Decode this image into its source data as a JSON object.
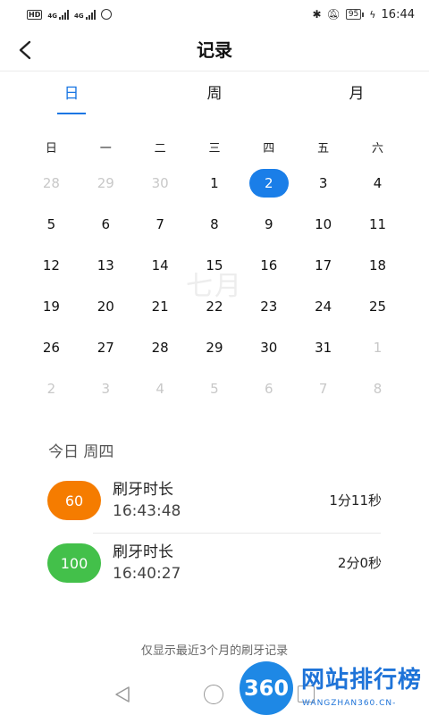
{
  "status_bar": {
    "hd": "HD",
    "network_1": "4G",
    "network_2": "4G",
    "battery": "95",
    "time": "16:44"
  },
  "header": {
    "title": "记录",
    "back_icon": "chevron-left-icon"
  },
  "tabs": [
    {
      "label": "日",
      "active": true
    },
    {
      "label": "周",
      "active": false
    },
    {
      "label": "月",
      "active": false
    }
  ],
  "calendar": {
    "weekdays": [
      "日",
      "一",
      "二",
      "三",
      "四",
      "五",
      "六"
    ],
    "month_watermark": "七月",
    "weeks": [
      [
        {
          "d": "28",
          "muted": true
        },
        {
          "d": "29",
          "muted": true
        },
        {
          "d": "30",
          "muted": true
        },
        {
          "d": "1"
        },
        {
          "d": "2",
          "selected": true
        },
        {
          "d": "3"
        },
        {
          "d": "4"
        }
      ],
      [
        {
          "d": "5"
        },
        {
          "d": "6"
        },
        {
          "d": "7"
        },
        {
          "d": "8"
        },
        {
          "d": "9"
        },
        {
          "d": "10"
        },
        {
          "d": "11"
        }
      ],
      [
        {
          "d": "12"
        },
        {
          "d": "13"
        },
        {
          "d": "14"
        },
        {
          "d": "15"
        },
        {
          "d": "16"
        },
        {
          "d": "17"
        },
        {
          "d": "18"
        }
      ],
      [
        {
          "d": "19"
        },
        {
          "d": "20"
        },
        {
          "d": "21"
        },
        {
          "d": "22"
        },
        {
          "d": "23"
        },
        {
          "d": "24"
        },
        {
          "d": "25"
        }
      ],
      [
        {
          "d": "26"
        },
        {
          "d": "27"
        },
        {
          "d": "28"
        },
        {
          "d": "29"
        },
        {
          "d": "30"
        },
        {
          "d": "31"
        },
        {
          "d": "1",
          "muted": true
        }
      ],
      [
        {
          "d": "2",
          "muted": true
        },
        {
          "d": "3",
          "muted": true
        },
        {
          "d": "4",
          "muted": true
        },
        {
          "d": "5",
          "muted": true
        },
        {
          "d": "6",
          "muted": true
        },
        {
          "d": "7",
          "muted": true
        },
        {
          "d": "8",
          "muted": true
        }
      ]
    ]
  },
  "records_section": {
    "day_label": "今日 周四",
    "records": [
      {
        "score": "60",
        "color": "#f57c00",
        "label": "刷牙时长",
        "time": "16:43:48",
        "duration": "1分11秒"
      },
      {
        "score": "100",
        "color": "#43c04a",
        "label": "刷牙时长",
        "time": "16:40:27",
        "duration": "2分0秒"
      }
    ],
    "note": "仅显示最近3个月的刷牙记录"
  },
  "logo": {
    "number": "360",
    "name": "网站排行榜",
    "sub": "WANGZHAN360.CN-"
  },
  "colors": {
    "accent": "#1976e3",
    "selected_day": "#1a7ee8"
  }
}
